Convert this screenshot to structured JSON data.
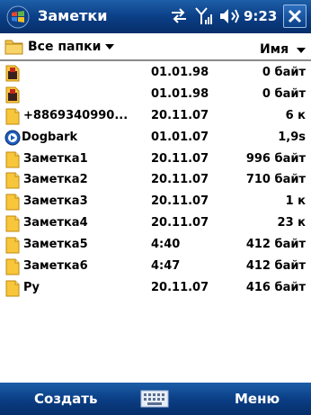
{
  "title_bar": {
    "app_title": "Заметки",
    "time": "9:23"
  },
  "filter_bar": {
    "folder_label": "Все папки",
    "sort_label": "Имя"
  },
  "files": [
    {
      "icon": "voice-note-icon",
      "name": "",
      "date": "01.01.98",
      "size": "0 байт"
    },
    {
      "icon": "voice-note-icon",
      "name": "",
      "date": "01.01.98",
      "size": "0 байт"
    },
    {
      "icon": "note-icon",
      "name": "+8869340990...",
      "date": "20.11.07",
      "size": "6 к"
    },
    {
      "icon": "media-icon",
      "name": "Dogbark",
      "date": "01.01.07",
      "size": "1,9s"
    },
    {
      "icon": "note-icon",
      "name": "Заметка1",
      "date": "20.11.07",
      "size": "996 байт"
    },
    {
      "icon": "note-icon",
      "name": "Заметка2",
      "date": "20.11.07",
      "size": "710 байт"
    },
    {
      "icon": "note-icon",
      "name": "Заметка3",
      "date": "20.11.07",
      "size": "1 к"
    },
    {
      "icon": "note-icon",
      "name": "Заметка4",
      "date": "20.11.07",
      "size": "23 к"
    },
    {
      "icon": "note-icon",
      "name": "Заметка5",
      "date": "4:40",
      "size": "412 байт"
    },
    {
      "icon": "note-icon",
      "name": "Заметка6",
      "date": "4:47",
      "size": "412 байт"
    },
    {
      "icon": "note-icon",
      "name": "Ру",
      "date": "20.11.07",
      "size": "416 байт"
    }
  ],
  "menu_bar": {
    "left_soft_key": "Создать",
    "right_soft_key": "Меню"
  },
  "colors": {
    "bar_blue": "#0b3f86",
    "note_yellow": "#f7c63b",
    "separator": "#8a8a8a"
  }
}
